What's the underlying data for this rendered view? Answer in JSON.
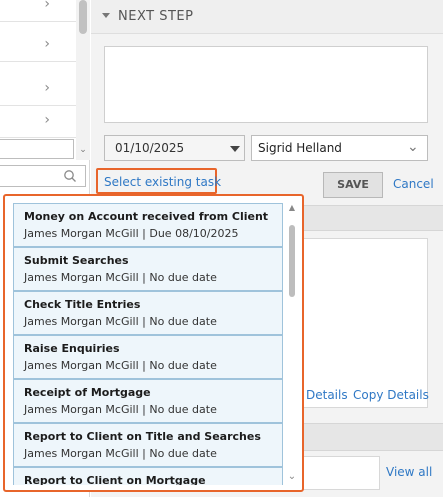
{
  "left_panel": {
    "rows": [
      {
        "chevron": "chevron-right-icon"
      },
      {
        "chevron": "chevron-right-icon"
      },
      {
        "chevron": "chevron-right-icon"
      },
      {
        "chevron": "chevron-right-icon"
      },
      {
        "chevron": "chevron-right-icon"
      }
    ]
  },
  "next_step": {
    "title": "NEXT STEP",
    "note_value": "",
    "date_value": "01/10/2025",
    "assignee_value": "Sigrid Helland",
    "select_existing_label": "Select existing task",
    "save_label": "SAVE",
    "cancel_label": "Cancel"
  },
  "details": {
    "details_label": "Details",
    "copy_details_label": "Copy Details"
  },
  "lower": {
    "view_all_label": "View all"
  },
  "task_dropdown": {
    "tasks": [
      {
        "title": "Money on Account received from Client",
        "subtitle": "James Morgan McGill | Due 08/10/2025"
      },
      {
        "title": "Submit Searches",
        "subtitle": "James Morgan McGill | No due date"
      },
      {
        "title": "Check Title Entries",
        "subtitle": "James Morgan McGill | No due date"
      },
      {
        "title": "Raise Enquiries",
        "subtitle": "James Morgan McGill | No due date"
      },
      {
        "title": "Receipt of Mortgage",
        "subtitle": "James Morgan McGill | No due date"
      },
      {
        "title": "Report to Client on Title and Searches",
        "subtitle": "James Morgan McGill | No due date"
      },
      {
        "title": "Report to Client on Mortgage",
        "subtitle": ""
      }
    ]
  },
  "colors": {
    "accent_border": "#e8652b",
    "link": "#2f78c5",
    "task_bg": "#eef6fb",
    "task_border": "#9fc3db"
  }
}
